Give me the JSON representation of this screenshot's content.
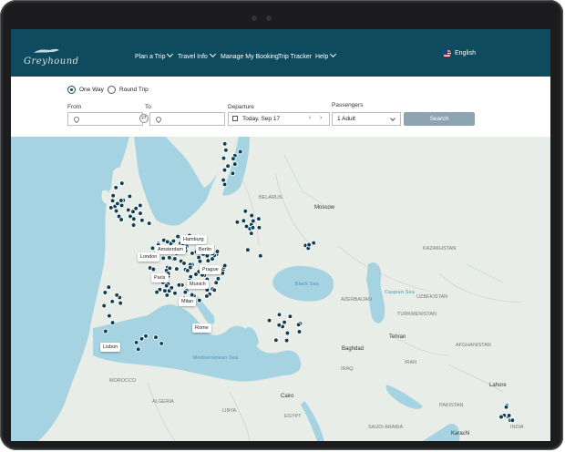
{
  "brand": {
    "logo_text": "Greyhound"
  },
  "nav": {
    "items": [
      {
        "label": "Plan a Trip",
        "has_menu": true
      },
      {
        "label": "Travel Info",
        "has_menu": true
      },
      {
        "label": "Manage My Booking",
        "has_menu": false
      },
      {
        "label": "Trip Tracker",
        "has_menu": false
      },
      {
        "label": "Help",
        "has_menu": true
      }
    ],
    "language": "English",
    "language_icon": "us-flag-icon"
  },
  "search": {
    "trip_types": [
      {
        "label": "One Way",
        "selected": true
      },
      {
        "label": "Round Trip",
        "selected": false
      }
    ],
    "from_label": "From",
    "from_value": "",
    "to_label": "To",
    "to_value": "",
    "departure_label": "Departure",
    "departure_value": "Today, Sep 17",
    "passengers_label": "Passengers",
    "passengers_value": "1 Adult",
    "search_button": "Search"
  },
  "map": {
    "city_callouts": [
      "Hamburg",
      "Amsterdam",
      "Berlin",
      "London",
      "Paris",
      "Prague",
      "Munich",
      "Milan",
      "Rome",
      "Lisbon"
    ],
    "place_labels": [
      "Moscow",
      "Baghdad",
      "Tehran",
      "Cairo",
      "Karachi",
      "Lahore"
    ],
    "region_labels": [
      "KAZAKHSTAN",
      "UZBEKISTAN",
      "TURKMENISTAN",
      "AFGHANISTAN",
      "AZERBAIJAN",
      "IRAQ",
      "IRAN",
      "MOROCCO",
      "ALGERIA",
      "LIBYA",
      "EGYPT",
      "SAUDI ARABIA",
      "PAKISTAN",
      "INDIA",
      "BELARUS"
    ],
    "sea_labels": [
      "Black Sea",
      "Caspian Sea",
      "Mediterranean Sea"
    ],
    "colors": {
      "land": "#e9ede7",
      "sea": "#a6d3e2",
      "marker": "#0f3e52",
      "header": "#0f4b5f"
    }
  }
}
